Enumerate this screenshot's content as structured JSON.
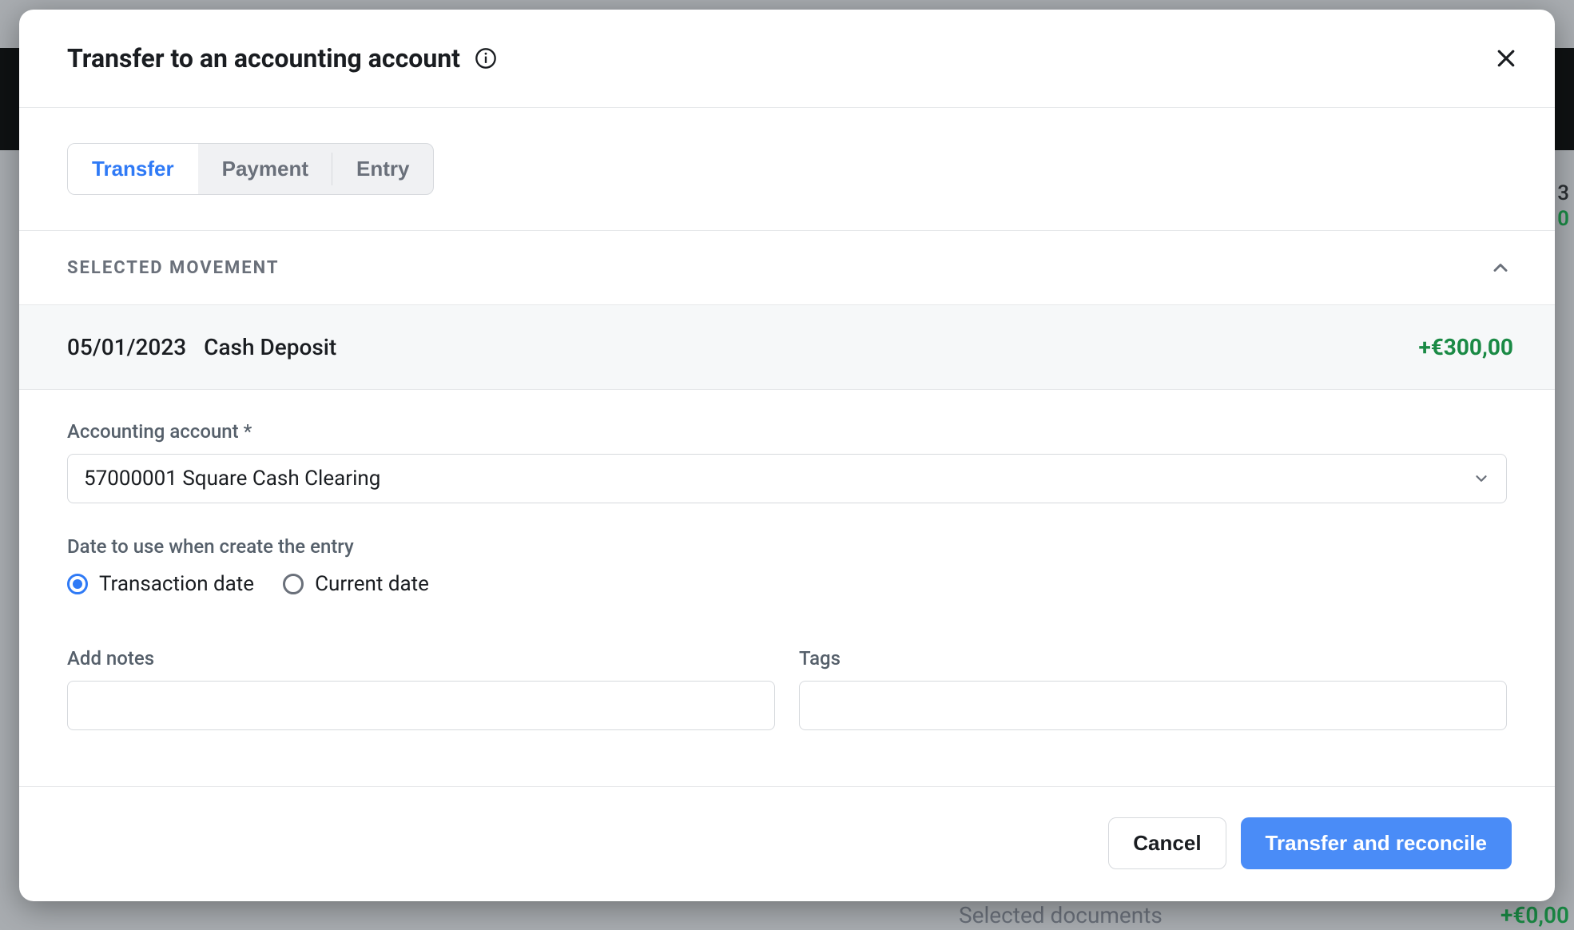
{
  "background": {
    "side_number": "3",
    "side_amount_small": "0",
    "selected_documents_label": "Selected documents",
    "selected_documents_amount": "+€0,00"
  },
  "modal": {
    "title": "Transfer to an accounting account",
    "tabs": {
      "transfer": "Transfer",
      "payment": "Payment",
      "entry": "Entry"
    },
    "section_header": "SELECTED MOVEMENT",
    "movement": {
      "date": "05/01/2023",
      "description": "Cash Deposit",
      "amount": "+€300,00"
    },
    "account": {
      "label": "Accounting account *",
      "value": "57000001 Square Cash Clearing"
    },
    "date_choice": {
      "label": "Date to use when create the entry",
      "transaction": "Transaction date",
      "current": "Current date"
    },
    "notes_label": "Add notes",
    "tags_label": "Tags",
    "footer": {
      "cancel": "Cancel",
      "confirm": "Transfer and reconcile"
    }
  }
}
